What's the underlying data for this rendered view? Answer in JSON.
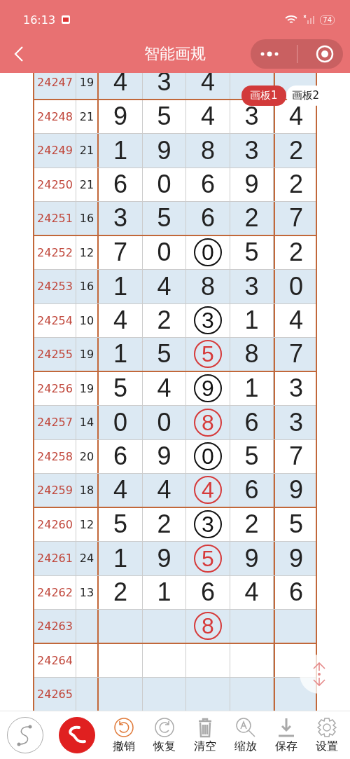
{
  "status_bar": {
    "time": "16:13",
    "battery": "74"
  },
  "header": {
    "title": "智能画规"
  },
  "tabs": [
    {
      "label": "画板1",
      "selected": true
    },
    {
      "label": "画板2",
      "selected": false
    }
  ],
  "rows": [
    {
      "issue": "24247",
      "sum": "19",
      "cells": [
        "4",
        "3",
        "4",
        null,
        null
      ]
    },
    {
      "issue": "24248",
      "sum": "21",
      "cells": [
        "9",
        "5",
        "4",
        "3",
        "4"
      ]
    },
    {
      "issue": "24249",
      "sum": "21",
      "cells": [
        "1",
        "9",
        "8",
        "3",
        "2"
      ]
    },
    {
      "issue": "24250",
      "sum": "21",
      "cells": [
        "6",
        "0",
        "6",
        "9",
        "2"
      ]
    },
    {
      "issue": "24251",
      "sum": "16",
      "cells": [
        "3",
        "5",
        "6",
        "2",
        "7"
      ]
    },
    {
      "issue": "24252",
      "sum": "12",
      "cells": [
        "7",
        "0",
        {
          "value": "0",
          "color": "#111111"
        },
        "5",
        "2"
      ]
    },
    {
      "issue": "24253",
      "sum": "16",
      "cells": [
        "1",
        "4",
        "8",
        "3",
        "0"
      ]
    },
    {
      "issue": "24254",
      "sum": "10",
      "cells": [
        "4",
        "2",
        {
          "value": "3",
          "color": "#111111"
        },
        "1",
        "4"
      ]
    },
    {
      "issue": "24255",
      "sum": "19",
      "cells": [
        "1",
        "5",
        {
          "value": "5",
          "color": "#d63a3a"
        },
        "8",
        "7"
      ]
    },
    {
      "issue": "24256",
      "sum": "19",
      "cells": [
        "5",
        "4",
        {
          "value": "9",
          "color": "#111111"
        },
        "1",
        "3"
      ]
    },
    {
      "issue": "24257",
      "sum": "14",
      "cells": [
        "0",
        "0",
        {
          "value": "8",
          "color": "#d63a3a"
        },
        "6",
        "3"
      ]
    },
    {
      "issue": "24258",
      "sum": "20",
      "cells": [
        "6",
        "9",
        {
          "value": "0",
          "color": "#111111"
        },
        "5",
        "7"
      ]
    },
    {
      "issue": "24259",
      "sum": "18",
      "cells": [
        "4",
        "4",
        {
          "value": "4",
          "color": "#d63a3a"
        },
        "6",
        "9"
      ]
    },
    {
      "issue": "24260",
      "sum": "12",
      "cells": [
        "5",
        "2",
        {
          "value": "3",
          "color": "#111111"
        },
        "2",
        "5"
      ]
    },
    {
      "issue": "24261",
      "sum": "24",
      "cells": [
        "1",
        "9",
        {
          "value": "5",
          "color": "#d63a3a"
        },
        "9",
        "9"
      ]
    },
    {
      "issue": "24262",
      "sum": "13",
      "cells": [
        "2",
        "1",
        "6",
        "4",
        "6"
      ]
    },
    {
      "issue": "24263",
      "cells": [
        null,
        null,
        {
          "value": "8",
          "color": "#d63a3a"
        },
        null,
        null
      ]
    },
    {
      "issue": "24264",
      "cells": [
        null,
        null,
        null,
        null,
        null
      ]
    },
    {
      "issue": "24265",
      "cells": [
        null,
        null,
        null,
        null,
        null
      ]
    }
  ],
  "modes": [
    {
      "selected": false
    },
    {
      "selected": true
    }
  ],
  "tools": [
    {
      "kind": "undo",
      "label": "撤销",
      "highlighted": true
    },
    {
      "kind": "redo",
      "label": "恢复",
      "highlighted": false
    },
    {
      "kind": "clear",
      "label": "清空",
      "highlighted": false
    },
    {
      "kind": "zoom",
      "label": "缩放",
      "highlighted": false
    },
    {
      "kind": "save",
      "label": "保存",
      "highlighted": false
    },
    {
      "kind": "settings",
      "label": "设置",
      "highlighted": false
    }
  ]
}
